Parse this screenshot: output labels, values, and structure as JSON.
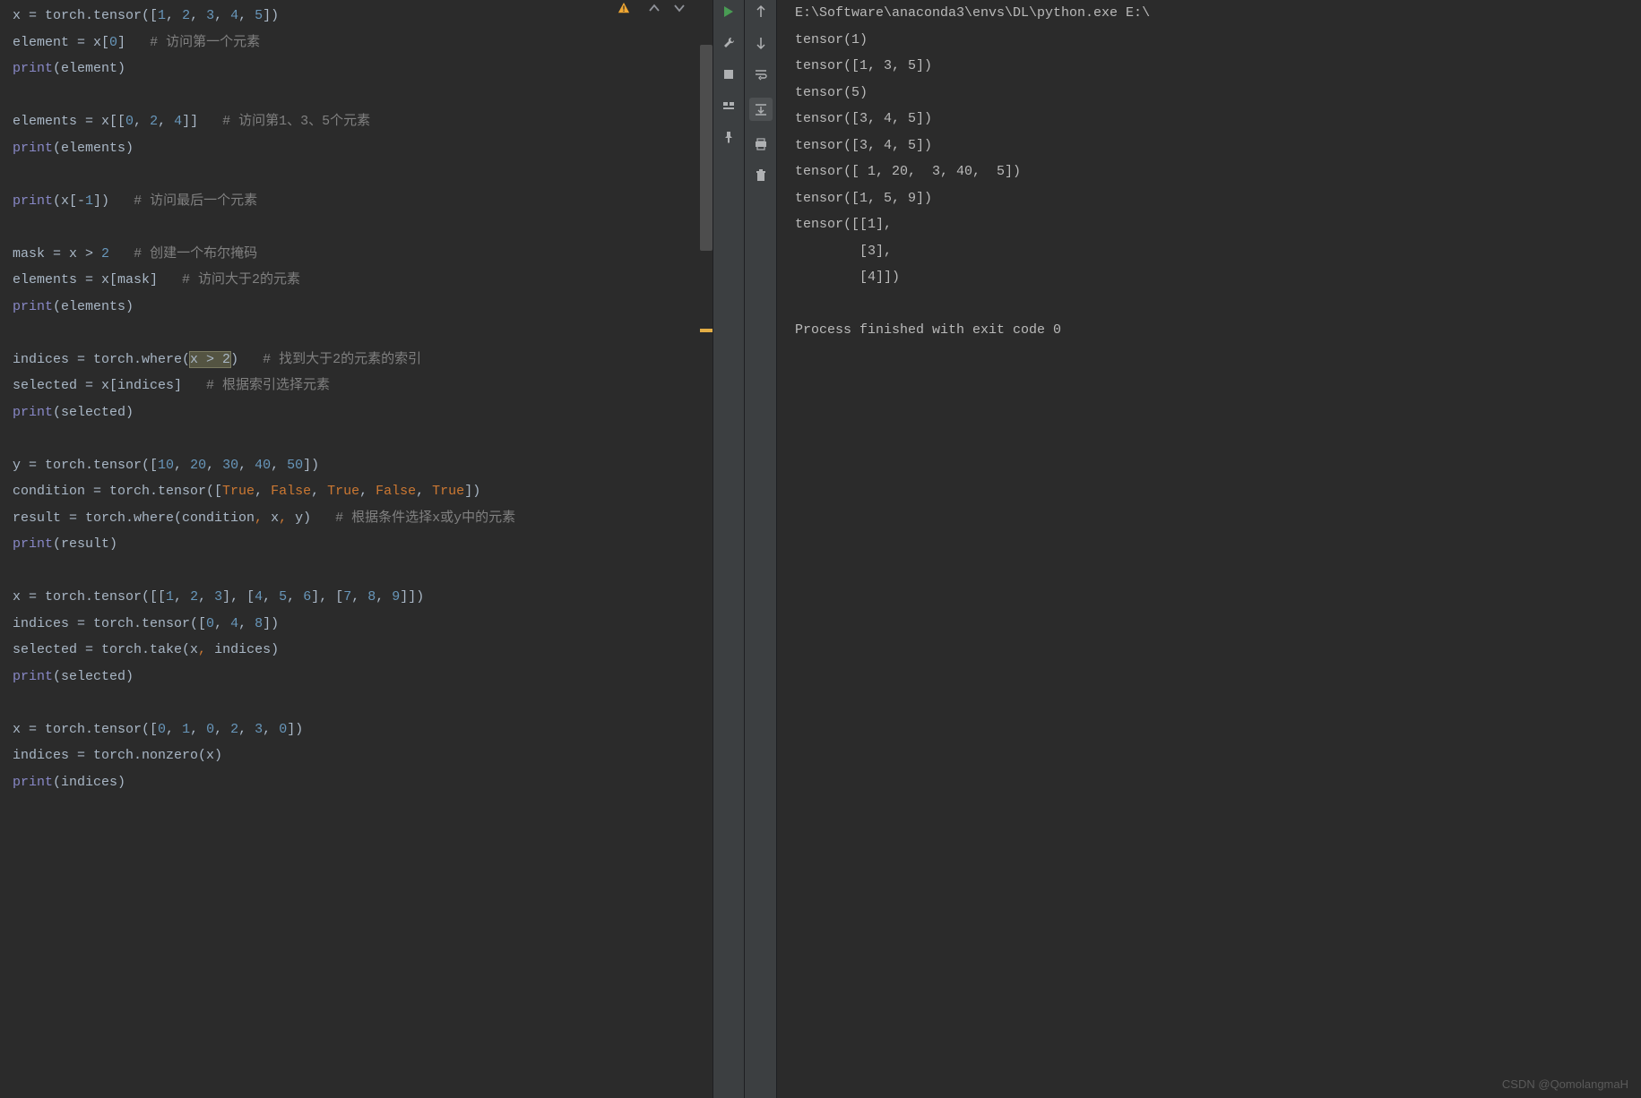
{
  "editor": {
    "lines": [
      {
        "type": "code",
        "segments": [
          {
            "t": "x = torch.tensor([",
            "c": "c-identifier"
          },
          {
            "t": "1",
            "c": "c-number"
          },
          {
            "t": ", ",
            "c": "c-identifier"
          },
          {
            "t": "2",
            "c": "c-number"
          },
          {
            "t": ", ",
            "c": "c-identifier"
          },
          {
            "t": "3",
            "c": "c-number"
          },
          {
            "t": ", ",
            "c": "c-identifier"
          },
          {
            "t": "4",
            "c": "c-number"
          },
          {
            "t": ", ",
            "c": "c-identifier"
          },
          {
            "t": "5",
            "c": "c-number"
          },
          {
            "t": "])",
            "c": "c-identifier"
          }
        ]
      },
      {
        "type": "code",
        "segments": [
          {
            "t": "element = x[",
            "c": "c-identifier"
          },
          {
            "t": "0",
            "c": "c-number"
          },
          {
            "t": "]   ",
            "c": "c-identifier"
          },
          {
            "t": "# 访问第一个元素",
            "c": "c-comment"
          }
        ]
      },
      {
        "type": "code",
        "segments": [
          {
            "t": "print",
            "c": "c-builtin"
          },
          {
            "t": "(element)",
            "c": "c-identifier"
          }
        ]
      },
      {
        "type": "blank"
      },
      {
        "type": "code",
        "segments": [
          {
            "t": "elements = x[[",
            "c": "c-identifier"
          },
          {
            "t": "0",
            "c": "c-number"
          },
          {
            "t": ", ",
            "c": "c-identifier"
          },
          {
            "t": "2",
            "c": "c-number"
          },
          {
            "t": ", ",
            "c": "c-identifier"
          },
          {
            "t": "4",
            "c": "c-number"
          },
          {
            "t": "]]   ",
            "c": "c-identifier"
          },
          {
            "t": "# 访问第1、3、5个元素",
            "c": "c-comment"
          }
        ]
      },
      {
        "type": "code",
        "segments": [
          {
            "t": "print",
            "c": "c-builtin"
          },
          {
            "t": "(elements)",
            "c": "c-identifier"
          }
        ]
      },
      {
        "type": "blank"
      },
      {
        "type": "code",
        "segments": [
          {
            "t": "print",
            "c": "c-builtin"
          },
          {
            "t": "(x[-",
            "c": "c-identifier"
          },
          {
            "t": "1",
            "c": "c-number"
          },
          {
            "t": "])   ",
            "c": "c-identifier"
          },
          {
            "t": "# 访问最后一个元素",
            "c": "c-comment"
          }
        ]
      },
      {
        "type": "blank"
      },
      {
        "type": "code",
        "segments": [
          {
            "t": "mask = x > ",
            "c": "c-identifier"
          },
          {
            "t": "2",
            "c": "c-number"
          },
          {
            "t": "   ",
            "c": "c-identifier"
          },
          {
            "t": "# 创建一个布尔掩码",
            "c": "c-comment"
          }
        ]
      },
      {
        "type": "code",
        "segments": [
          {
            "t": "elements = x[mask]   ",
            "c": "c-identifier"
          },
          {
            "t": "# 访问大于2的元素",
            "c": "c-comment"
          }
        ]
      },
      {
        "type": "code",
        "segments": [
          {
            "t": "print",
            "c": "c-builtin"
          },
          {
            "t": "(elements)",
            "c": "c-identifier"
          }
        ]
      },
      {
        "type": "blank"
      },
      {
        "type": "code",
        "segments": [
          {
            "t": "indices = torch.where(",
            "c": "c-identifier"
          },
          {
            "t": "x > 2",
            "c": "c-identifier",
            "sel": true
          },
          {
            "t": ")   ",
            "c": "c-identifier"
          },
          {
            "t": "# 找到大于2的元素的索引",
            "c": "c-comment"
          }
        ]
      },
      {
        "type": "code",
        "segments": [
          {
            "t": "selected = x[indices]   ",
            "c": "c-identifier"
          },
          {
            "t": "# 根据索引选择元素",
            "c": "c-comment"
          }
        ]
      },
      {
        "type": "code",
        "segments": [
          {
            "t": "print",
            "c": "c-builtin"
          },
          {
            "t": "(selected)",
            "c": "c-identifier"
          }
        ]
      },
      {
        "type": "blank"
      },
      {
        "type": "code",
        "segments": [
          {
            "t": "y = torch.tensor([",
            "c": "c-identifier"
          },
          {
            "t": "10",
            "c": "c-number"
          },
          {
            "t": ", ",
            "c": "c-identifier"
          },
          {
            "t": "20",
            "c": "c-number"
          },
          {
            "t": ", ",
            "c": "c-identifier"
          },
          {
            "t": "30",
            "c": "c-number"
          },
          {
            "t": ", ",
            "c": "c-identifier"
          },
          {
            "t": "40",
            "c": "c-number"
          },
          {
            "t": ", ",
            "c": "c-identifier"
          },
          {
            "t": "50",
            "c": "c-number"
          },
          {
            "t": "])",
            "c": "c-identifier"
          }
        ]
      },
      {
        "type": "code",
        "segments": [
          {
            "t": "condition = torch.tensor([",
            "c": "c-identifier"
          },
          {
            "t": "True",
            "c": "c-keyword"
          },
          {
            "t": ", ",
            "c": "c-identifier"
          },
          {
            "t": "False",
            "c": "c-keyword"
          },
          {
            "t": ", ",
            "c": "c-identifier"
          },
          {
            "t": "True",
            "c": "c-keyword"
          },
          {
            "t": ", ",
            "c": "c-identifier"
          },
          {
            "t": "False",
            "c": "c-keyword"
          },
          {
            "t": ", ",
            "c": "c-identifier"
          },
          {
            "t": "True",
            "c": "c-keyword"
          },
          {
            "t": "])",
            "c": "c-identifier"
          }
        ]
      },
      {
        "type": "code",
        "segments": [
          {
            "t": "result = torch.where(condition",
            "c": "c-identifier"
          },
          {
            "t": ", ",
            "c": "c-keyword"
          },
          {
            "t": "x",
            "c": "c-identifier"
          },
          {
            "t": ", ",
            "c": "c-keyword"
          },
          {
            "t": "y)   ",
            "c": "c-identifier"
          },
          {
            "t": "# 根据条件选择x或y中的元素",
            "c": "c-comment"
          }
        ]
      },
      {
        "type": "code",
        "segments": [
          {
            "t": "print",
            "c": "c-builtin"
          },
          {
            "t": "(result)",
            "c": "c-identifier"
          }
        ]
      },
      {
        "type": "blank"
      },
      {
        "type": "code",
        "segments": [
          {
            "t": "x = torch.tensor([[",
            "c": "c-identifier"
          },
          {
            "t": "1",
            "c": "c-number"
          },
          {
            "t": ", ",
            "c": "c-identifier"
          },
          {
            "t": "2",
            "c": "c-number"
          },
          {
            "t": ", ",
            "c": "c-identifier"
          },
          {
            "t": "3",
            "c": "c-number"
          },
          {
            "t": "], [",
            "c": "c-identifier"
          },
          {
            "t": "4",
            "c": "c-number"
          },
          {
            "t": ", ",
            "c": "c-identifier"
          },
          {
            "t": "5",
            "c": "c-number"
          },
          {
            "t": ", ",
            "c": "c-identifier"
          },
          {
            "t": "6",
            "c": "c-number"
          },
          {
            "t": "], [",
            "c": "c-identifier"
          },
          {
            "t": "7",
            "c": "c-number"
          },
          {
            "t": ", ",
            "c": "c-identifier"
          },
          {
            "t": "8",
            "c": "c-number"
          },
          {
            "t": ", ",
            "c": "c-identifier"
          },
          {
            "t": "9",
            "c": "c-number"
          },
          {
            "t": "]])",
            "c": "c-identifier"
          }
        ]
      },
      {
        "type": "code",
        "segments": [
          {
            "t": "indices = torch.tensor([",
            "c": "c-identifier"
          },
          {
            "t": "0",
            "c": "c-number"
          },
          {
            "t": ", ",
            "c": "c-identifier"
          },
          {
            "t": "4",
            "c": "c-number"
          },
          {
            "t": ", ",
            "c": "c-identifier"
          },
          {
            "t": "8",
            "c": "c-number"
          },
          {
            "t": "])",
            "c": "c-identifier"
          }
        ]
      },
      {
        "type": "code",
        "segments": [
          {
            "t": "selected = torch.take(x",
            "c": "c-identifier"
          },
          {
            "t": ", ",
            "c": "c-keyword"
          },
          {
            "t": "indices)",
            "c": "c-identifier"
          }
        ]
      },
      {
        "type": "code",
        "segments": [
          {
            "t": "print",
            "c": "c-builtin"
          },
          {
            "t": "(selected)",
            "c": "c-identifier"
          }
        ]
      },
      {
        "type": "blank"
      },
      {
        "type": "code",
        "segments": [
          {
            "t": "x = torch.tensor([",
            "c": "c-identifier"
          },
          {
            "t": "0",
            "c": "c-number"
          },
          {
            "t": ", ",
            "c": "c-identifier"
          },
          {
            "t": "1",
            "c": "c-number"
          },
          {
            "t": ", ",
            "c": "c-identifier"
          },
          {
            "t": "0",
            "c": "c-number"
          },
          {
            "t": ", ",
            "c": "c-identifier"
          },
          {
            "t": "2",
            "c": "c-number"
          },
          {
            "t": ", ",
            "c": "c-identifier"
          },
          {
            "t": "3",
            "c": "c-number"
          },
          {
            "t": ", ",
            "c": "c-identifier"
          },
          {
            "t": "0",
            "c": "c-number"
          },
          {
            "t": "])",
            "c": "c-identifier"
          }
        ]
      },
      {
        "type": "code",
        "segments": [
          {
            "t": "indices = torch.nonzero(x)",
            "c": "c-identifier"
          }
        ]
      },
      {
        "type": "code",
        "segments": [
          {
            "t": "print",
            "c": "c-builtin"
          },
          {
            "t": "(indices)",
            "c": "c-identifier"
          }
        ]
      }
    ]
  },
  "output": {
    "lines": [
      "E:\\Software\\anaconda3\\envs\\DL\\python.exe E:\\",
      "tensor(1)",
      "tensor([1, 3, 5])",
      "tensor(5)",
      "tensor([3, 4, 5])",
      "tensor([3, 4, 5])",
      "tensor([ 1, 20,  3, 40,  5])",
      "tensor([1, 5, 9])",
      "tensor([[1],",
      "        [3],",
      "        [4]])",
      "",
      "Process finished with exit code 0"
    ]
  },
  "toolbar1": {
    "run_icon": "run",
    "wrench_icon": "wrench",
    "stop_icon": "stop",
    "layout_icon": "layout",
    "pin_icon": "pin"
  },
  "toolbar2": {
    "up_icon": "arrow-up",
    "down_icon": "arrow-down",
    "wrap_icon": "wrap",
    "scroll_icon": "scroll",
    "print_icon": "print",
    "trash_icon": "trash"
  },
  "watermark": "CSDN @QomolangmaH"
}
